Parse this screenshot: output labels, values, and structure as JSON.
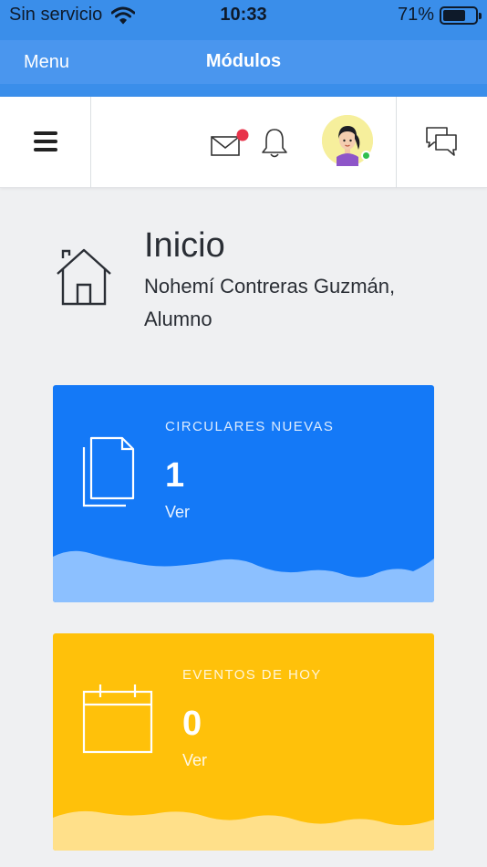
{
  "status_bar": {
    "carrier": "Sin servicio",
    "time": "10:33",
    "battery_percent": "71%",
    "battery_level": 0.71
  },
  "nav_bar": {
    "back_label": "Menu",
    "title": "Módulos"
  },
  "header": {
    "icons": [
      "menu-icon",
      "mail-icon",
      "bell-icon",
      "avatar",
      "chat-icon"
    ],
    "mail_has_notification": true,
    "notification_color": "#e8334a",
    "online_status_color": "#2fbf4f"
  },
  "page": {
    "title": "Inicio",
    "subtitle": "Nohemí Contreras Guzmán, Alumno",
    "icon": "home-icon"
  },
  "cards": [
    {
      "label": "CIRCULARES NUEVAS",
      "count": "1",
      "link": "Ver",
      "icon": "documents-icon",
      "color": "#1479f7",
      "wave_color": "#8cc0ff"
    },
    {
      "label": "EVENTOS DE HOY",
      "count": "0",
      "link": "Ver",
      "icon": "calendar-icon",
      "color": "#ffc10a",
      "wave_color": "#ffe08a"
    }
  ]
}
